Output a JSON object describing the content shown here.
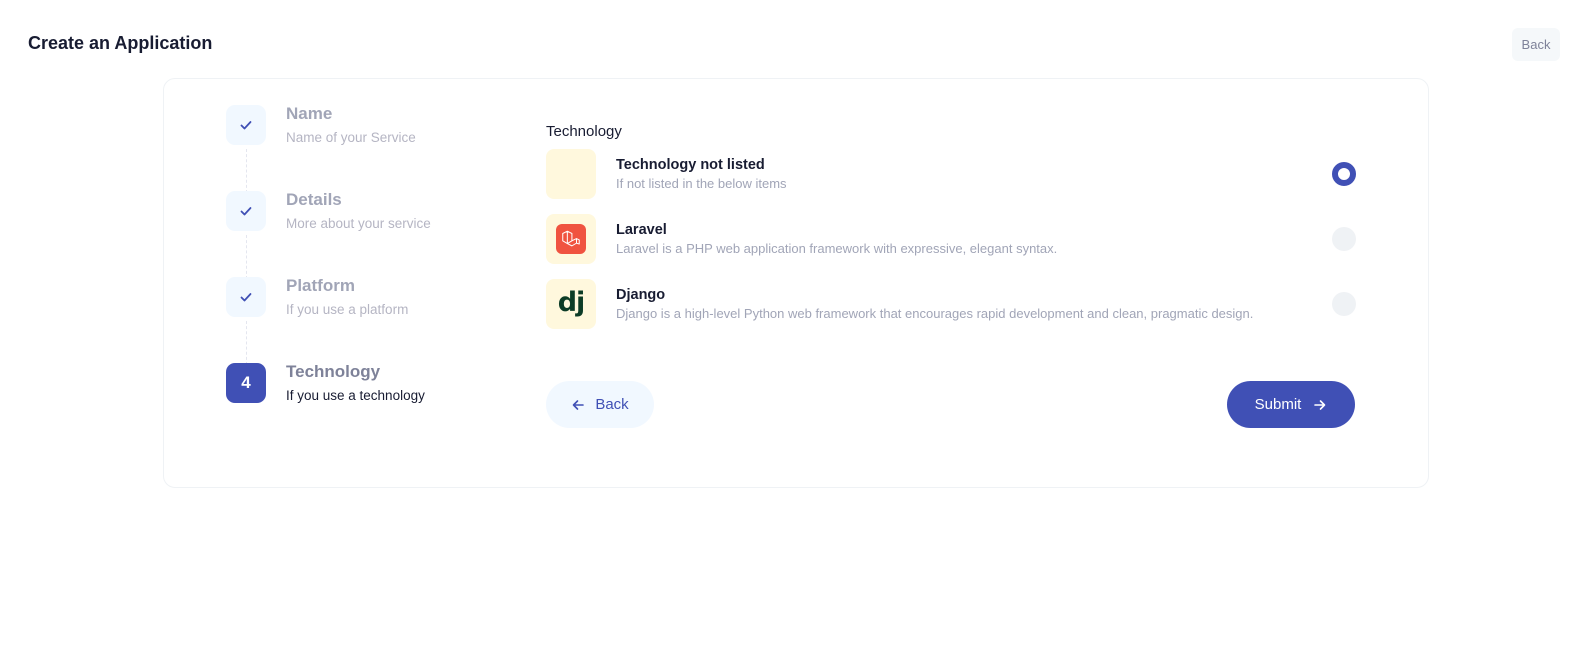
{
  "header": {
    "title": "Create an Application",
    "back_label": "Back"
  },
  "stepper": {
    "steps": [
      {
        "title": "Name",
        "description": "Name of your Service",
        "status": "completed",
        "icon": "check-icon"
      },
      {
        "title": "Details",
        "description": "More about your service",
        "status": "completed",
        "icon": "check-icon"
      },
      {
        "title": "Platform",
        "description": "If you use a platform",
        "status": "completed",
        "icon": "check-icon"
      },
      {
        "title": "Technology",
        "description": "If you use a technology",
        "status": "current",
        "number": "4"
      }
    ]
  },
  "technology": {
    "section_label": "Technology",
    "options": [
      {
        "title": "Technology not listed",
        "description": "If not listed in the below items",
        "icon": "blank-icon",
        "selected": true
      },
      {
        "title": "Laravel",
        "description": "Laravel is a PHP web application framework with expressive, elegant syntax.",
        "icon": "laravel-logo-icon",
        "selected": false
      },
      {
        "title": "Django",
        "description": "Django is a high-level Python web framework that encourages rapid development and clean, pragmatic design.",
        "icon": "django-logo-icon",
        "logo_text": "dj",
        "selected": false
      }
    ]
  },
  "actions": {
    "back_label": "Back",
    "submit_label": "Submit"
  },
  "colors": {
    "primary": "#4050b5",
    "light_primary": "#f1f8ff",
    "option_icon_bg": "#fff8dd",
    "laravel_red": "#f05340",
    "django_green": "#0c3c26"
  }
}
